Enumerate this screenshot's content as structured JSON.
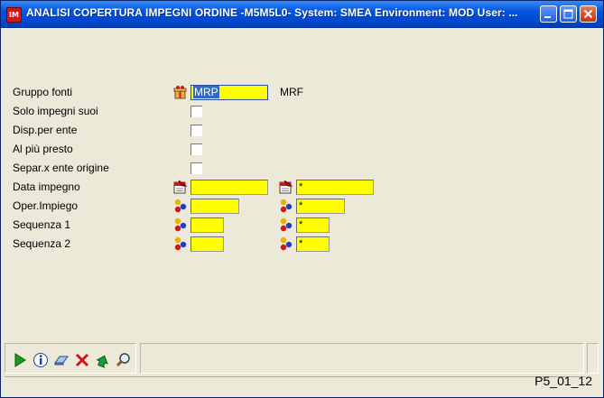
{
  "window": {
    "title": "ANALISI COPERTURA IMPEGNI ORDINE -M5M5L0- System: SMEA Environment: MOD User: ...",
    "app_icon_text": "IM"
  },
  "form": {
    "gruppo_fonti": {
      "label": "Gruppo fonti",
      "value": "MRP",
      "extra": "MRF"
    },
    "solo_impegni_suoi": {
      "label": "Solo impegni suoi"
    },
    "disp_per_ente": {
      "label": "Disp.per ente"
    },
    "al_piu_presto": {
      "label": "Al più presto"
    },
    "separ_ente_origine": {
      "label": "Separ.x ente origine"
    },
    "data_impegno": {
      "label": "Data impegno",
      "from": "",
      "to": "*"
    },
    "oper_impiego": {
      "label": "Oper.Impiego",
      "from": "",
      "to": "*"
    },
    "sequenza_1": {
      "label": "Sequenza 1",
      "from": "",
      "to": "*"
    },
    "sequenza_2": {
      "label": "Sequenza 2",
      "from": "",
      "to": "*"
    }
  },
  "toolbar": {
    "buttons": [
      "play-icon",
      "info-icon",
      "eraser-icon",
      "delete-icon",
      "back-icon",
      "zoom-icon"
    ]
  },
  "status": {
    "code": "P5_01_12"
  },
  "colors": {
    "field_bg": "#ffff00",
    "titlebar": "#0054e3",
    "window_bg": "#ece9d8"
  }
}
